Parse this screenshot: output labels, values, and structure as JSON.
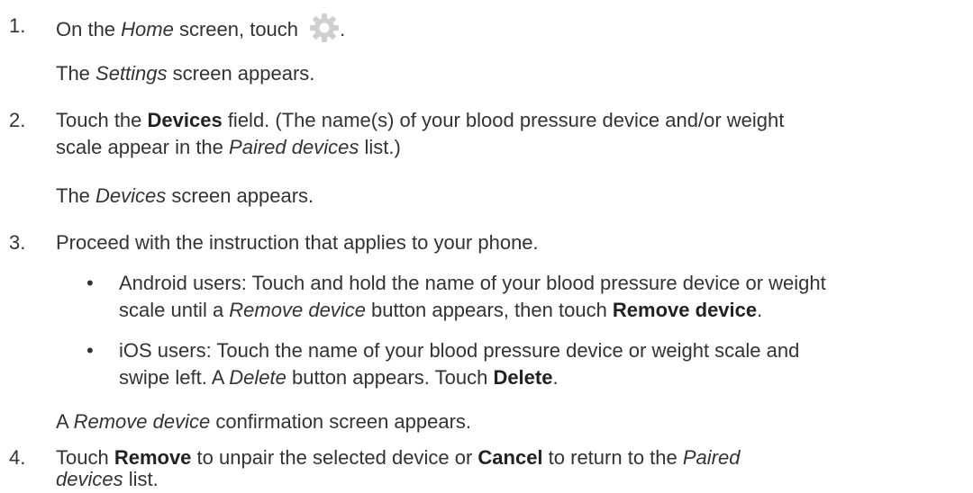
{
  "steps": [
    {
      "num": "1.",
      "a": "On the ",
      "a_i": "Home",
      "a2": " screen, touch ",
      "a3": ".",
      "result_i": "Settings",
      "result": " screen appears.",
      "result_pre": "The "
    },
    {
      "num": "2.",
      "a": "Touch the ",
      "a_b": "Devices",
      "a2": " field. (The name(s) of your blood pressure device and/or weight",
      "b": "scale appear in the ",
      "b_i": "Paired devices",
      "b2": " list.)",
      "result_pre": "The ",
      "result_i": "Devices",
      "result": " screen appears."
    },
    {
      "num": "3.",
      "a": "Proceed with the instruction that applies to your phone.",
      "bullets": [
        {
          "dot": "•",
          "l1": "Android users: Touch and hold the name of your blood pressure device or weight",
          "l2a": "scale until a ",
          "l2i": "Remove device",
          "l2b": " button appears, then touch ",
          "l2bold": "Remove device",
          "l2c": "."
        },
        {
          "dot": "•",
          "l1": "iOS users: Touch the name of your blood pressure device or weight scale and",
          "l2a": "swipe left. A ",
          "l2i": "Delete",
          "l2b": " button appears. Touch ",
          "l2bold": "Delete",
          "l2c": "."
        }
      ],
      "result_pre": "A ",
      "result_i": "Remove device",
      "result": " confirmation screen appears."
    },
    {
      "num": "4.",
      "a": "Touch ",
      "a_b": "Remove",
      "a2": " to unpair the selected device or ",
      "a_b2": "Cancel",
      "a3": " to return to the ",
      "a_i": "Paired",
      "b_i": "devices",
      "b2": " list."
    }
  ],
  "icons": {
    "settings": "gear-icon",
    "gear_color": "#cfcfcf"
  }
}
